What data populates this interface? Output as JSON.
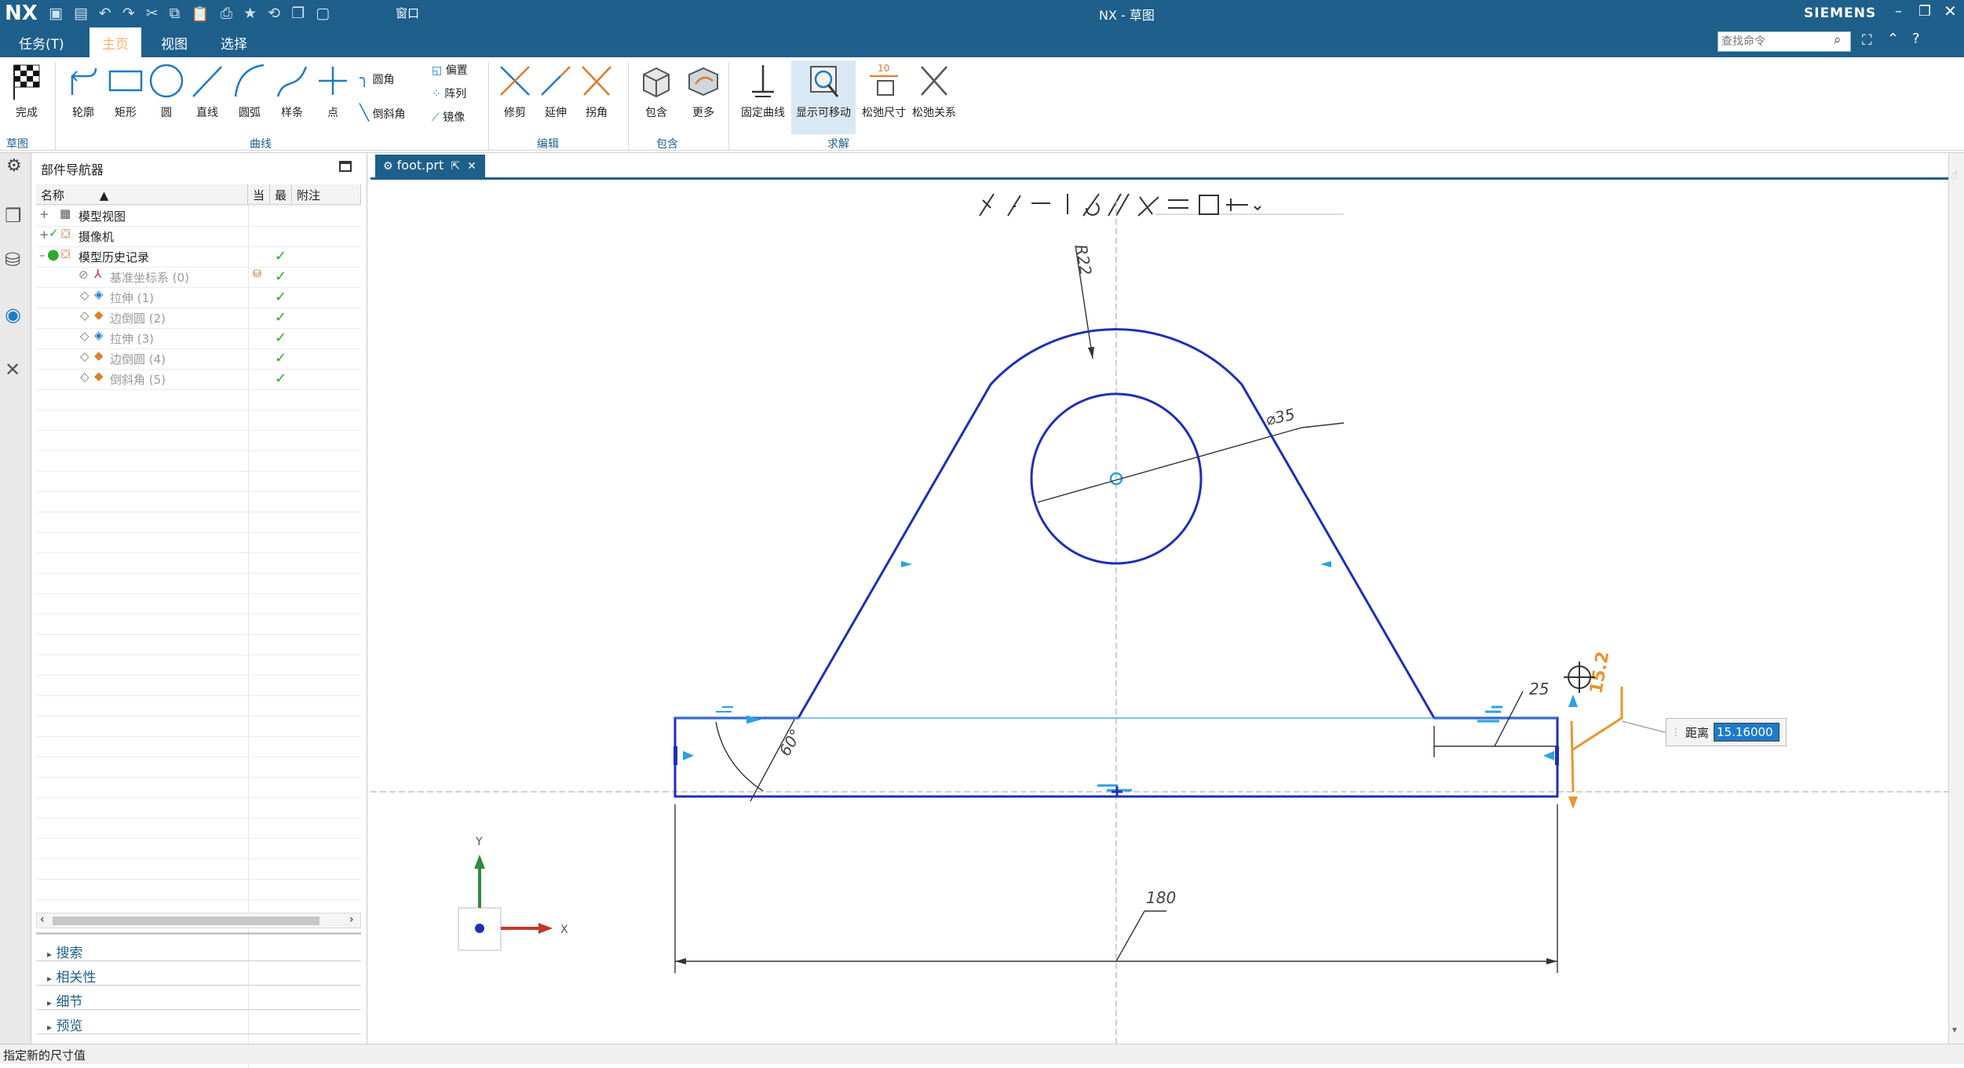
{
  "title": {
    "logo": "NX",
    "window_title": "NX - 草图",
    "brand": "SIEMENS",
    "window_label": "窗口"
  },
  "menu": [
    "任务(T)",
    "主页",
    "视图",
    "选择"
  ],
  "search": {
    "placeholder": "查找命令"
  },
  "ribbon": {
    "finish": "完成",
    "curve_buttons": [
      "轮廓",
      "矩形",
      "圆",
      "直线",
      "圆弧",
      "样条",
      "点"
    ],
    "curve_small": [
      "圆角",
      "倒斜角"
    ],
    "curve_small2": [
      "偏置",
      "阵列",
      "镜像"
    ],
    "edit_buttons": [
      "修剪",
      "延伸",
      "拐角"
    ],
    "include_buttons": [
      "包含",
      "更多"
    ],
    "solve_buttons": [
      "固定曲线",
      "显示可移动",
      "松弛尺寸",
      "松弛关系"
    ],
    "relax_dim_value": "10",
    "groups": {
      "sketch": "草图",
      "curve": "曲线",
      "edit": "编辑",
      "include": "包含",
      "solve": "求解"
    }
  },
  "navigator": {
    "title": "部件导航器",
    "columns": [
      "名称",
      "当",
      "最",
      "附注"
    ],
    "nodes": [
      {
        "label": "模型视图",
        "active": true
      },
      {
        "label": "摄像机",
        "active": true
      },
      {
        "label": "模型历史记录",
        "active": true
      },
      {
        "label": "基准坐标系 (0)",
        "active": false
      },
      {
        "label": "拉伸 (1)",
        "active": false
      },
      {
        "label": "边倒圆 (2)",
        "active": false
      },
      {
        "label": "拉伸 (3)",
        "active": false
      },
      {
        "label": "边倒圆 (4)",
        "active": false
      },
      {
        "label": "倒斜角 (5)",
        "active": false
      }
    ],
    "sections": [
      "搜索",
      "相关性",
      "细节",
      "预览"
    ]
  },
  "tab": {
    "label": "foot.prt"
  },
  "sketch": {
    "dimensions": {
      "radius": "R22",
      "diameter": "⌀35",
      "angle": "60°",
      "offset": "25",
      "width": "180",
      "active": "15.2"
    },
    "axis_labels": {
      "x": "X",
      "y": "Y"
    },
    "colors": {
      "sketch": "#1f2fb5",
      "active": "#e8952e",
      "chrome": "#1e5f8c"
    }
  },
  "dim_input": {
    "label": "距离",
    "value": "15.16000"
  },
  "status": "指定新的尺寸值"
}
